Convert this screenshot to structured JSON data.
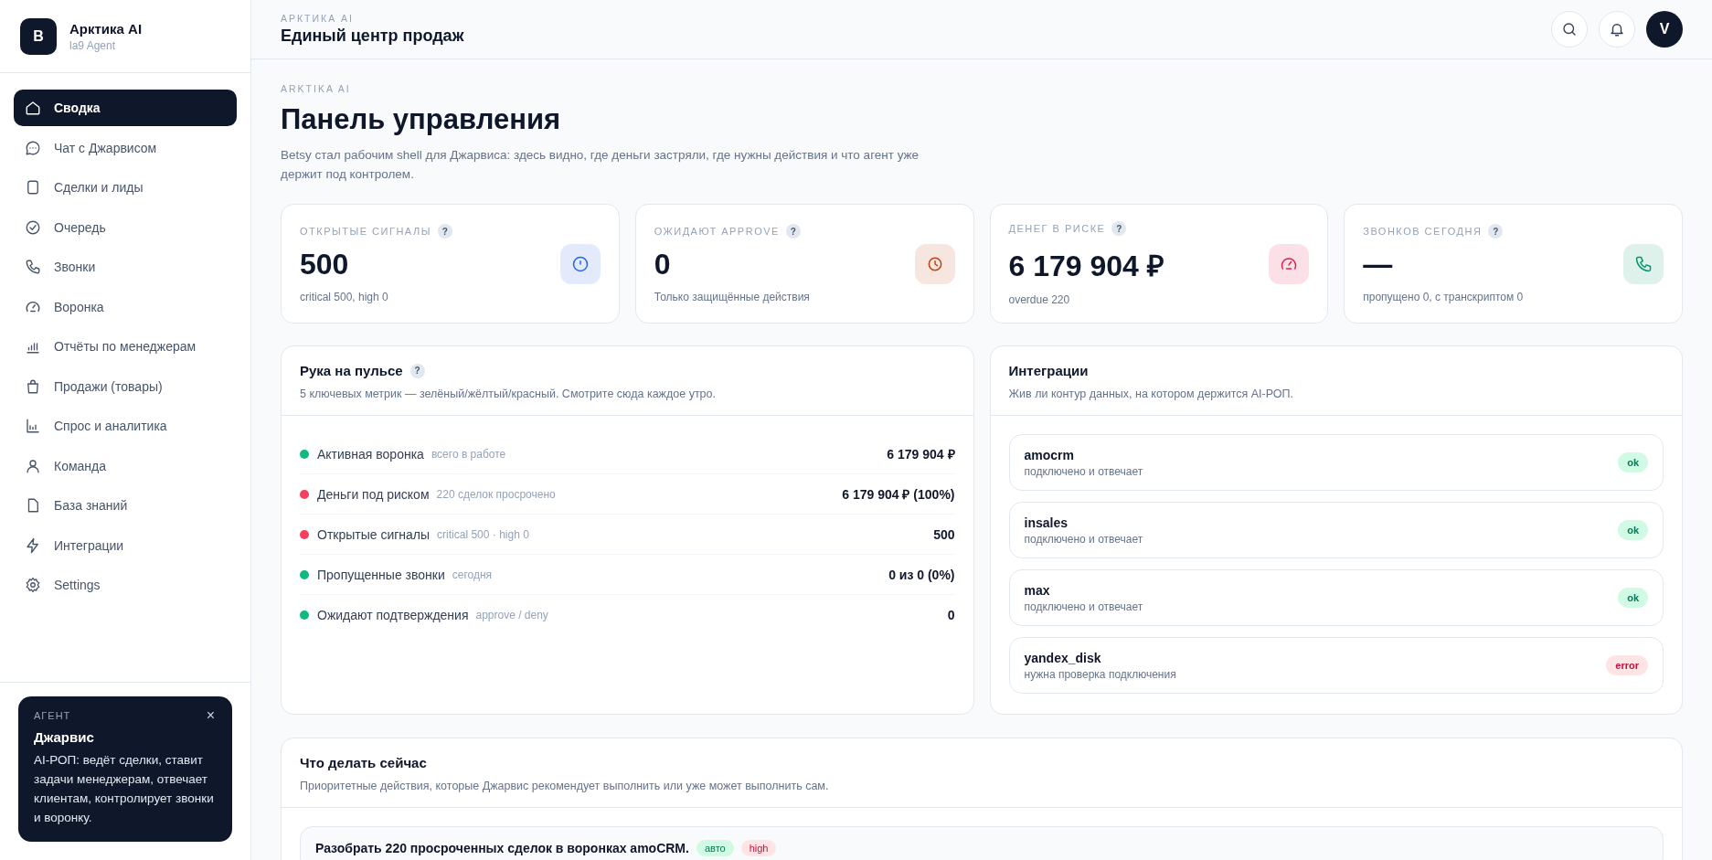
{
  "sidebar": {
    "brand": {
      "logo": "B",
      "name": "Арктика AI",
      "subtitle": "la9 Agent"
    },
    "nav": [
      {
        "label": "Сводка",
        "kind": "home",
        "selected": true
      },
      {
        "label": "Чат с Джарвисом",
        "kind": "chat",
        "selected": false
      },
      {
        "label": "Сделки и лиды",
        "kind": "doc",
        "selected": false
      },
      {
        "label": "Очередь",
        "kind": "check",
        "selected": false
      },
      {
        "label": "Звонки",
        "kind": "phone",
        "selected": false
      },
      {
        "label": "Воронка",
        "kind": "gauge",
        "selected": false
      },
      {
        "label": "Отчёты по менеджерам",
        "kind": "bars",
        "selected": false
      },
      {
        "label": "Продажи (товары)",
        "kind": "bag",
        "selected": false
      },
      {
        "label": "Спрос и аналитика",
        "kind": "chart",
        "selected": false
      },
      {
        "label": "Команда",
        "kind": "user",
        "selected": false
      },
      {
        "label": "База знаний",
        "kind": "file",
        "selected": false
      },
      {
        "label": "Интеграции",
        "kind": "bolt",
        "selected": false
      },
      {
        "label": "Settings",
        "kind": "gear",
        "selected": false
      }
    ],
    "agent": {
      "eyebrow": "АГЕНТ",
      "close": "×",
      "title": "Джарвис",
      "text": "AI-РОП: ведёт сделки, ставит задачи менеджерам, отвечает клиентам, контролирует звонки и воронку."
    }
  },
  "header": {
    "eyebrow": "АРКТИКА AI",
    "title": "Единый центр продаж",
    "avatar": "V"
  },
  "page": {
    "eyebrow": "ARKTIKA AI",
    "title": "Панель управления",
    "description": "Betsy стал рабочим shell для Джарвиса: здесь видно, где деньги застряли, где нужны действия и что агент уже держит под контролем."
  },
  "kpis": [
    {
      "label": "ОТКРЫТЫЕ СИГНАЛЫ",
      "help": "?",
      "value": "500",
      "note": "critical 500, high 0",
      "kind": "alert",
      "color": "#2563eb"
    },
    {
      "label": "ОЖИДАЮТ APPROVE",
      "help": "?",
      "value": "0",
      "note": "Только защищённые действия",
      "kind": "clock",
      "color": "#c2410c"
    },
    {
      "label": "ДЕНЕГ В РИСКЕ",
      "help": "?",
      "value": "6 179 904 ₽",
      "note": "overdue 220",
      "kind": "gauge",
      "color": "#e11d48"
    },
    {
      "label": "ЗВОНКОВ СЕГОДНЯ",
      "help": "?",
      "value": "—",
      "note": "пропущено 0, с транскриптом 0",
      "kind": "phone",
      "color": "#059669"
    }
  ],
  "pulse": {
    "title": "Рука на пульсе",
    "help": "?",
    "subtitle": "5 ключевых метрик — зелёный/жёлтый/красный. Смотрите сюда каждое утро.",
    "rows": [
      {
        "label": "Активная воронка",
        "hint": "всего в работе",
        "value": "6 179 904 ₽",
        "color": "#10b981"
      },
      {
        "label": "Деньги под риском",
        "hint": "220 сделок просрочено",
        "value": "6 179 904 ₽ (100%)",
        "color": "#f43f5e"
      },
      {
        "label": "Открытые сигналы",
        "hint": "critical 500 · high 0",
        "value": "500",
        "color": "#f43f5e"
      },
      {
        "label": "Пропущенные звонки",
        "hint": "сегодня",
        "value": "0 из 0 (0%)",
        "color": "#10b981"
      },
      {
        "label": "Ожидают подтверждения",
        "hint": "approve / deny",
        "value": "0",
        "color": "#10b981"
      }
    ]
  },
  "integrations": {
    "title": "Интеграции",
    "subtitle": "Жив ли контур данных, на котором держится AI-РОП.",
    "items": [
      {
        "name": "amocrm",
        "status": "подключено и отвечает",
        "badge": "ok",
        "kind": "ok"
      },
      {
        "name": "insales",
        "status": "подключено и отвечает",
        "badge": "ok",
        "kind": "ok"
      },
      {
        "name": "max",
        "status": "подключено и отвечает",
        "badge": "ok",
        "kind": "ok"
      },
      {
        "name": "yandex_disk",
        "status": "нужна проверка подключения",
        "badge": "error",
        "kind": "error"
      }
    ]
  },
  "actions": {
    "title": "Что делать сейчас",
    "subtitle": "Приоритетные действия, которые Джарвис рекомендует выполнить или уже может выполнить сам.",
    "items": [
      {
        "title": "Разобрать 220 просроченных сделок в воронках amoCRM.",
        "tags": [
          {
            "label": "авто",
            "kind": "mode"
          },
          {
            "label": "high",
            "kind": "priority"
          }
        ]
      }
    ]
  }
}
